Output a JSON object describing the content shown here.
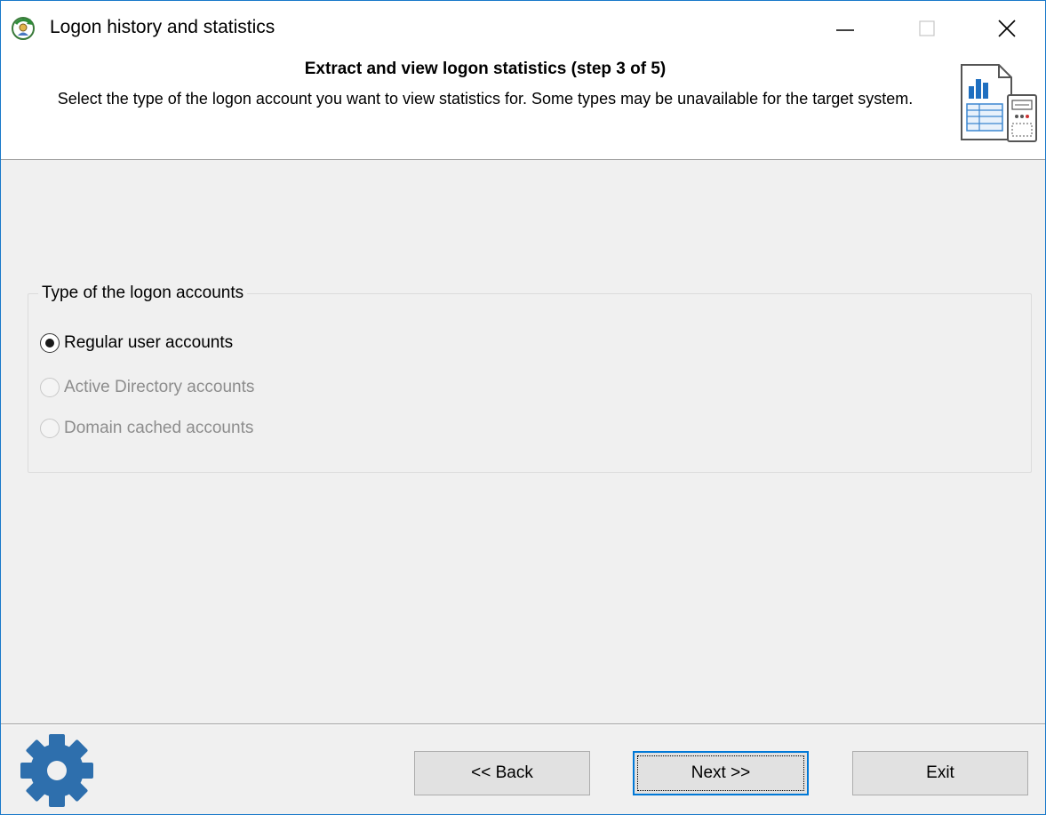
{
  "window": {
    "title": "Logon history and statistics"
  },
  "header": {
    "title": "Extract and view logon statistics (step 3 of 5)",
    "description": "Select the type of the logon account you want to view statistics for. Some types may be unavailable for the target system."
  },
  "group": {
    "label": "Type of the logon accounts",
    "options": [
      {
        "label": "Regular user accounts",
        "checked": true,
        "enabled": true
      },
      {
        "label": "Active Directory accounts",
        "checked": false,
        "enabled": false
      },
      {
        "label": "Domain cached accounts",
        "checked": false,
        "enabled": false
      }
    ]
  },
  "buttons": {
    "back": "<< Back",
    "next": "Next >>",
    "exit": "Exit"
  },
  "colors": {
    "accent": "#0078d7",
    "gear": "#2e6fad",
    "window_border": "#1979ca"
  },
  "icons": {
    "app": "logon-history-icon",
    "header": "statistics-report-icon",
    "footer": "gear-icon"
  }
}
